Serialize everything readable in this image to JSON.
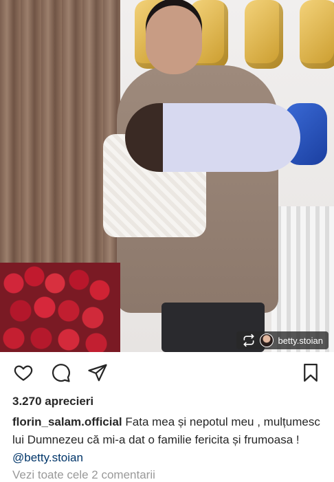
{
  "post": {
    "photo_alt_icon": "post-photo",
    "repost_tag": {
      "icon": "repost-icon",
      "username": "betty.stoian"
    }
  },
  "actions": {
    "like_icon": "heart-outline-icon",
    "comment_icon": "comment-icon",
    "share_icon": "send-icon",
    "save_icon": "bookmark-icon"
  },
  "likes_text": "3.270 aprecieri",
  "caption": {
    "username": "florin_salam.official",
    "text": " Fata mea și nepotul meu , mulțumesc lui Dumnezeu că mi-a dat o familie fericita și frumoasa ! ",
    "mention": "@betty.stoian"
  },
  "comments_link": "Vezi toate cele 2 comentarii",
  "colors": {
    "text": "#262626",
    "muted": "#999999",
    "mention": "#003569"
  }
}
